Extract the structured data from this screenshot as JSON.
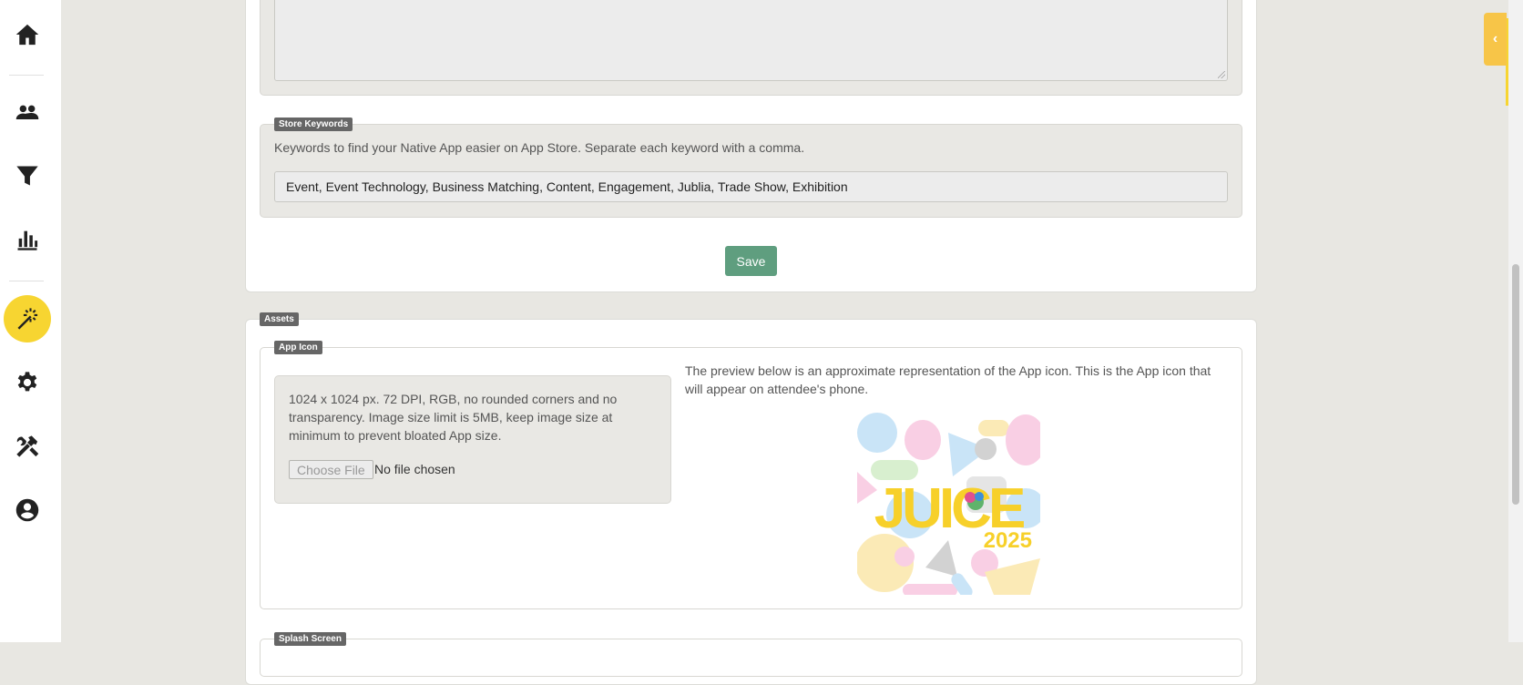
{
  "store_keywords": {
    "legend": "Store Keywords",
    "help": "Keywords to find your Native App easier on App Store. Separate each keyword with a comma.",
    "value": "Event, Event Technology, Business Matching, Content, Engagement, Jublia, Trade Show, Exhibition"
  },
  "save_label": "Save",
  "assets": {
    "legend": "Assets",
    "app_icon": {
      "legend": "App Icon",
      "requirements": "1024 x 1024 px. 72 DPI, RGB, no rounded corners and no transparency. Image size limit is 5MB, keep image size at minimum to prevent bloated App size.",
      "choose_file_label": "Choose File",
      "file_status": "No file chosen",
      "preview_note": "The preview below is an approximate representation of the App icon. This is the App icon that will appear on attendee's phone.",
      "preview_title": "JUICE",
      "preview_year": "2025"
    },
    "splash_screen": {
      "legend": "Splash Screen"
    }
  },
  "sidebar": {
    "items": [
      {
        "icon": "home-icon"
      },
      {
        "icon": "people-icon"
      },
      {
        "icon": "filter-icon"
      },
      {
        "icon": "bar-chart-icon"
      },
      {
        "icon": "magic-wand-icon",
        "active": true
      },
      {
        "icon": "gear-icon"
      },
      {
        "icon": "tools-icon"
      },
      {
        "icon": "account-icon"
      }
    ]
  },
  "colors": {
    "accent": "#f7d531",
    "save_button": "#5f9e7f",
    "legend_bg": "#666666"
  }
}
